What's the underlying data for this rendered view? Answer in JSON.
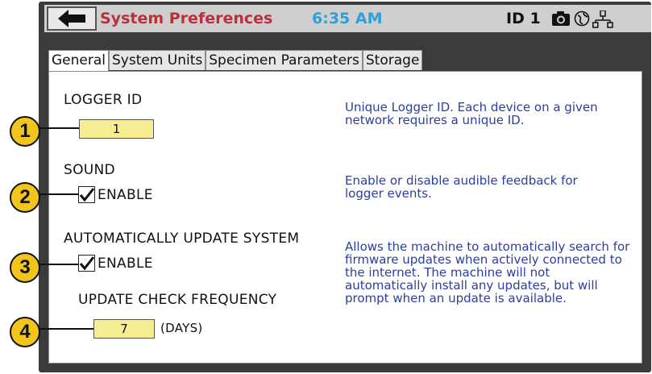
{
  "header": {
    "title": "System Preferences",
    "time": "6:35 AM",
    "id_label": "ID 1",
    "icons": [
      "back-arrow-icon",
      "camera-icon",
      "globe-icon",
      "network-icon"
    ]
  },
  "tabs": [
    {
      "label": "General",
      "active": true
    },
    {
      "label": "System Units",
      "active": false
    },
    {
      "label": "Specimen Parameters",
      "active": false
    },
    {
      "label": "Storage",
      "active": false
    }
  ],
  "logger_id": {
    "label": "LOGGER ID",
    "value": "1",
    "help": "Unique Logger ID.  Each device on a given network requires a unique ID."
  },
  "sound": {
    "label": "SOUND",
    "checkbox_label": "ENABLE",
    "checked": true,
    "help": "Enable or disable audible feedback for logger events."
  },
  "auto_update": {
    "label": "AUTOMATICALLY UPDATE SYSTEM",
    "checkbox_label": "ENABLE",
    "checked": true,
    "help": "Allows the machine to automatically search for firmware updates when actively connected to the internet.  The machine will not automatically install any updates, but will prompt when an update is available."
  },
  "update_frequency": {
    "label": "UPDATE CHECK FREQUENCY",
    "value": "7",
    "unit": "(DAYS)"
  },
  "callouts": [
    "1",
    "2",
    "3",
    "4"
  ],
  "colors": {
    "title": "#b8323c",
    "clock": "#2f9fdb",
    "help_text": "#2c3f9e",
    "field_bg": "#f6ee90",
    "callout_bg": "#f2c51c"
  }
}
